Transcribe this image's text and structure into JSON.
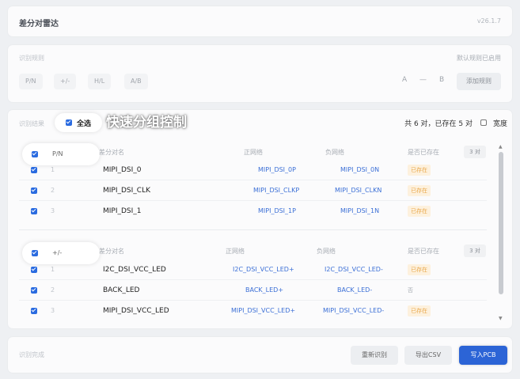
{
  "window": {
    "title": "差分对雷达",
    "version": "v26.1.7"
  },
  "rules": {
    "label": "识别规则",
    "status": "默认规则已启用",
    "chips": [
      "P/N",
      "+/-",
      "H/L",
      "A/B"
    ],
    "a_label": "A",
    "dash": "—",
    "b_label": "B",
    "add_rule": "添加规则"
  },
  "results": {
    "label": "识别结果",
    "select_all": "全选",
    "callout": "快速分组控制",
    "summary": "共 6 对，已存在 5 对",
    "width_label": "宽度",
    "columns": {
      "name": "差分对名",
      "pos": "正网络",
      "neg": "负网络",
      "exists": "是否已存在"
    },
    "groups": [
      {
        "label": "P/N",
        "count": "3 对",
        "rows": [
          {
            "idx": "1",
            "name": "MIPI_DSI_0",
            "pos": "MIPI_DSI_0P",
            "neg": "MIPI_DSI_0N",
            "exists": "已存在"
          },
          {
            "idx": "2",
            "name": "MIPI_DSI_CLK",
            "pos": "MIPI_DSI_CLKP",
            "neg": "MIPI_DSI_CLKN",
            "exists": "已存在"
          },
          {
            "idx": "3",
            "name": "MIPI_DSI_1",
            "pos": "MIPI_DSI_1P",
            "neg": "MIPI_DSI_1N",
            "exists": "已存在"
          }
        ]
      },
      {
        "label": "+/-",
        "count": "3 对",
        "rows": [
          {
            "idx": "1",
            "name": "I2C_DSI_VCC_LED",
            "pos": "I2C_DSI_VCC_LED+",
            "neg": "I2C_DSI_VCC_LED-",
            "exists": "已存在"
          },
          {
            "idx": "2",
            "name": "BACK_LED",
            "pos": "BACK_LED+",
            "neg": "BACK_LED-",
            "exists": "否"
          },
          {
            "idx": "3",
            "name": "MIPI_DSI_VCC_LED",
            "pos": "MIPI_DSI_VCC_LED+",
            "neg": "MIPI_DSI_VCC_LED-",
            "exists": "已存在"
          }
        ]
      }
    ]
  },
  "footer": {
    "status": "识别完成",
    "rescan": "重新识别",
    "export": "导出CSV",
    "write": "写入PCB"
  },
  "colors": {
    "accent": "#2c64d6",
    "net_link": "#3b6fd6",
    "exists_tag": "#e9a84a"
  }
}
